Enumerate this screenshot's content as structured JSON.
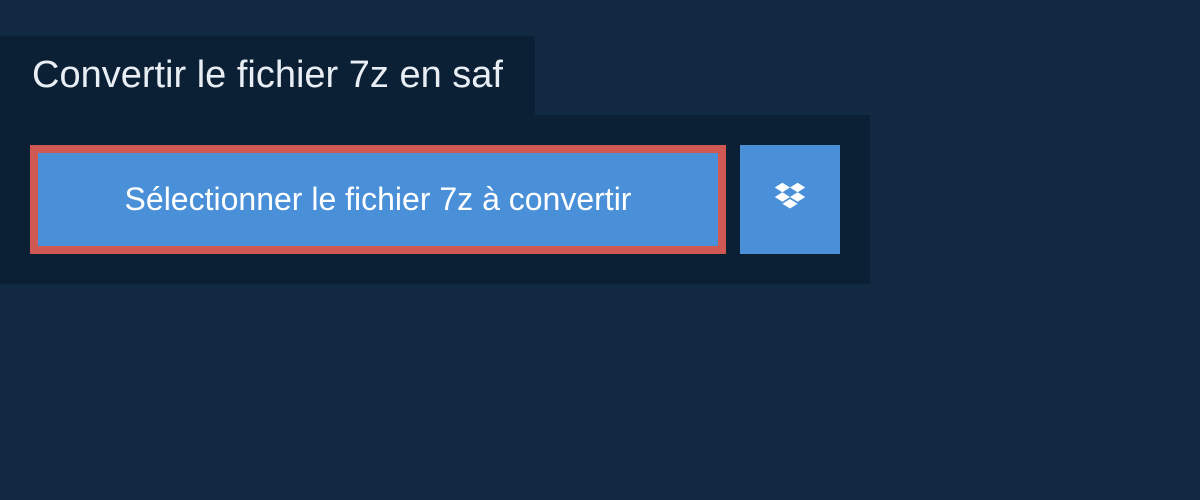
{
  "header": {
    "title": "Convertir le fichier 7z en saf"
  },
  "main": {
    "select_button_label": "Sélectionner le fichier 7z à convertir"
  }
}
